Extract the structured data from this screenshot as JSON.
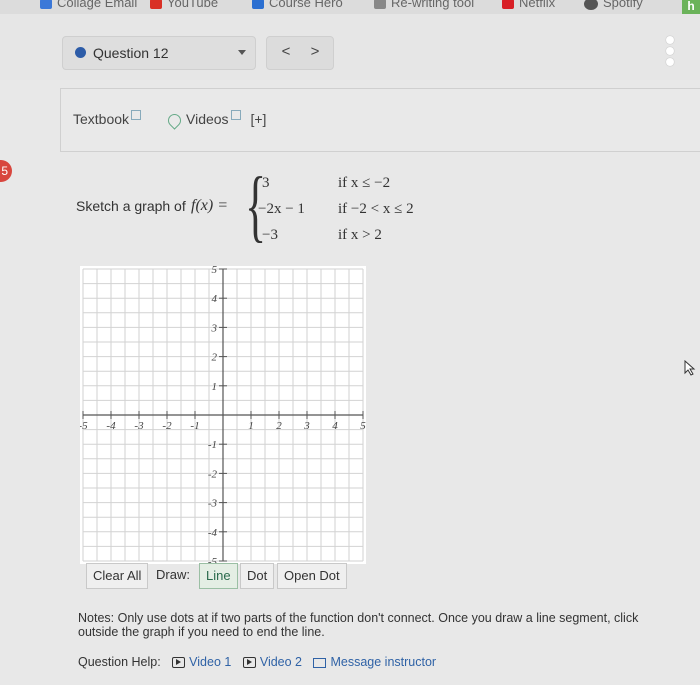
{
  "bookmarks": [
    {
      "label": "Collage Email",
      "color": "#3b78d8"
    },
    {
      "label": "YouTube",
      "color": "#d93025"
    },
    {
      "label": "Course Hero",
      "color": "#2b6fd1"
    },
    {
      "label": "Re-writing tool",
      "color": "#888888"
    },
    {
      "label": "Netflix",
      "color": "#d81f26"
    },
    {
      "label": "Spotify",
      "color": "#555555"
    }
  ],
  "bookmark_extra": "h",
  "question": {
    "label": "Question 12",
    "prev": "<",
    "next": ">"
  },
  "resources": {
    "textbook": "Textbook",
    "videos": "Videos",
    "more": "[+]"
  },
  "badge": "5",
  "problem": {
    "prompt": "Sketch a graph of",
    "function": "f(x) =",
    "pieces": [
      {
        "expr": "3",
        "cond": "if  x ≤ −2"
      },
      {
        "expr": "−2x − 1",
        "cond": "if  −2 < x ≤ 2"
      },
      {
        "expr": "−3",
        "cond": "if  x > 2"
      }
    ]
  },
  "graph": {
    "xmin": -5,
    "xmax": 5,
    "ymin": -5,
    "ymax": 5,
    "x_ticks": [
      "-5",
      "-4",
      "-3",
      "-2",
      "-1",
      "1",
      "2",
      "3",
      "4",
      "5"
    ],
    "y_ticks": [
      "5",
      "4",
      "3",
      "2",
      "1",
      "-1",
      "-2",
      "-3",
      "-4",
      "-5"
    ],
    "grid": true
  },
  "toolbar": {
    "clear": "Clear All",
    "draw": "Draw:",
    "line": "Line",
    "dot": "Dot",
    "open_dot": "Open Dot"
  },
  "notes": {
    "line1": "Notes: Only use dots at if two parts of the function don't connect. Once you draw a line segment, click",
    "line2": "outside the graph if you need to end the line."
  },
  "help": {
    "label": "Question Help:",
    "video1": "Video 1",
    "video2": "Video 2",
    "message": "Message instructor"
  }
}
